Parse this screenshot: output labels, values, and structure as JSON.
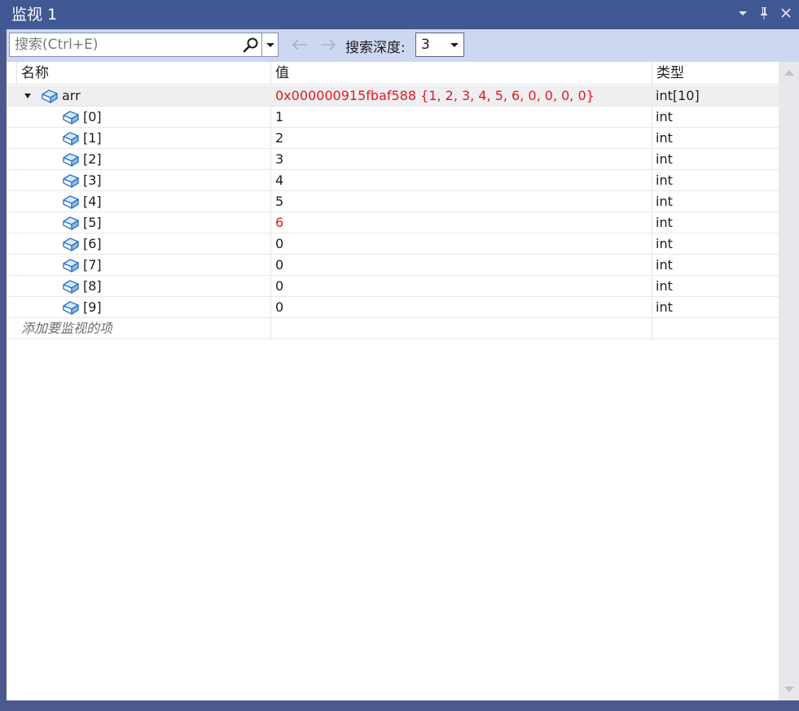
{
  "window": {
    "title": "监视 1"
  },
  "toolbar": {
    "search_placeholder": "搜索(Ctrl+E)",
    "depth_label": "搜索深度:",
    "depth_value": "3"
  },
  "columns": {
    "name": "名称",
    "value": "值",
    "type": "类型"
  },
  "rows": [
    {
      "name": "arr",
      "value": "0x000000915fbaf588 {1, 2, 3, 4, 5, 6, 0, 0, 0, 0}",
      "type": "int[10]",
      "changed": true
    },
    {
      "name": "[0]",
      "value": "1",
      "type": "int",
      "changed": false
    },
    {
      "name": "[1]",
      "value": "2",
      "type": "int",
      "changed": false
    },
    {
      "name": "[2]",
      "value": "3",
      "type": "int",
      "changed": false
    },
    {
      "name": "[3]",
      "value": "4",
      "type": "int",
      "changed": false
    },
    {
      "name": "[4]",
      "value": "5",
      "type": "int",
      "changed": false
    },
    {
      "name": "[5]",
      "value": "6",
      "type": "int",
      "changed": true
    },
    {
      "name": "[6]",
      "value": "0",
      "type": "int",
      "changed": false
    },
    {
      "name": "[7]",
      "value": "0",
      "type": "int",
      "changed": false
    },
    {
      "name": "[8]",
      "value": "0",
      "type": "int",
      "changed": false
    },
    {
      "name": "[9]",
      "value": "0",
      "type": "int",
      "changed": false
    }
  ],
  "add_item_placeholder": "添加要监视的项",
  "icons": {
    "dropdown": "caret-down-icon",
    "pin": "pin-icon",
    "close": "close-icon",
    "search": "search-icon",
    "back": "arrow-left-icon",
    "forward": "arrow-right-icon",
    "variable": "variable-icon"
  },
  "colors": {
    "titlebar": "#405893",
    "toolbar": "#cdd7f0",
    "changed_value": "#e8171d"
  }
}
